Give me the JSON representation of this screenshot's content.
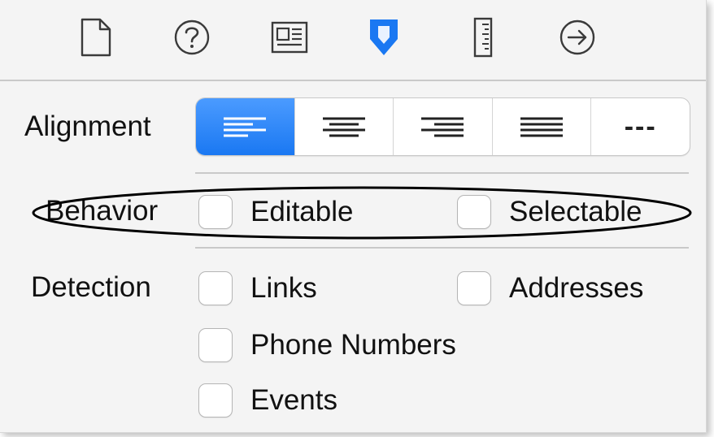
{
  "toolbar": {
    "icons": [
      {
        "name": "file-icon"
      },
      {
        "name": "help-icon"
      },
      {
        "name": "identity-icon"
      },
      {
        "name": "attributes-icon",
        "color": "#1a78f2"
      },
      {
        "name": "ruler-icon"
      },
      {
        "name": "connections-icon"
      }
    ]
  },
  "alignment": {
    "label": "Alignment",
    "options": [
      "left",
      "center",
      "right",
      "justified",
      "natural"
    ],
    "selected": "left",
    "natural_glyph": "---"
  },
  "behavior": {
    "label": "Behavior",
    "editable": {
      "label": "Editable",
      "checked": false
    },
    "selectable": {
      "label": "Selectable",
      "checked": false
    }
  },
  "detection": {
    "label": "Detection",
    "links": {
      "label": "Links",
      "checked": false
    },
    "addresses": {
      "label": "Addresses",
      "checked": false
    },
    "phone_numbers": {
      "label": "Phone Numbers",
      "checked": false
    },
    "events": {
      "label": "Events",
      "checked": false
    }
  },
  "colors": {
    "accent": "#1a78f2",
    "background": "#f4f4f4"
  }
}
